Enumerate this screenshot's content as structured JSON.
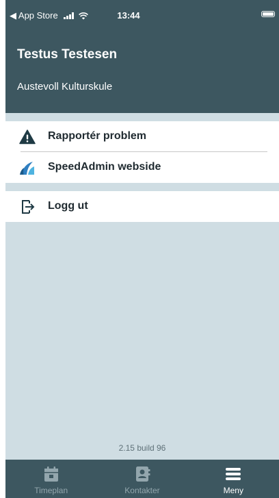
{
  "status_bar": {
    "back_label": "◀ App Store",
    "time": "13:44"
  },
  "header": {
    "user_name": "Testus Testesen",
    "school": "Austevoll Kulturskule"
  },
  "menu": {
    "items": [
      {
        "label": "Rapportér problem",
        "icon": "warning-icon"
      },
      {
        "label": "SpeedAdmin webside",
        "icon": "speedadmin-logo-icon"
      },
      {
        "label": "Logg ut",
        "icon": "logout-icon"
      }
    ]
  },
  "version": "2.15 build 96",
  "tabs": [
    {
      "label": "Timeplan",
      "icon": "calendar-icon",
      "active": false
    },
    {
      "label": "Kontakter",
      "icon": "contacts-icon",
      "active": false
    },
    {
      "label": "Meny",
      "icon": "menu-icon",
      "active": true
    }
  ],
  "colors": {
    "header_bg": "#3d5760",
    "page_bg": "#cfdde3",
    "tab_inactive": "#93a6ad",
    "tab_active": "#ffffff"
  }
}
